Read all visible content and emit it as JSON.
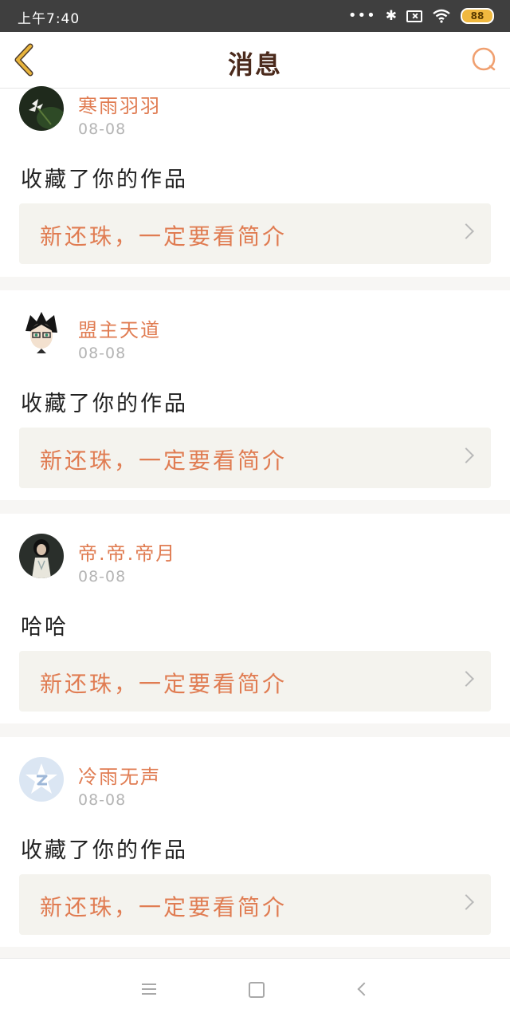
{
  "status_bar": {
    "time": "上午7:40",
    "dots": "•••",
    "bluetooth_glyph": "✱",
    "battery": "88"
  },
  "header": {
    "title": "消息",
    "back_icon": "chevron-left-icon",
    "search_icon": "search-icon"
  },
  "messages": [
    {
      "nickname": "寒雨羽羽",
      "date": "08-08",
      "text": "收藏了你的作品",
      "work_title": "新还珠，一定要看简介",
      "avatar": "flower-avatar"
    },
    {
      "nickname": "盟主天道",
      "date": "08-08",
      "text": "收藏了你的作品",
      "work_title": "新还珠，一定要看简介",
      "avatar": "anime-boy-avatar"
    },
    {
      "nickname": "帝.帝.帝月",
      "date": "08-08",
      "text": "哈哈",
      "work_title": "新还珠，一定要看简介",
      "avatar": "girl-avatar"
    },
    {
      "nickname": "冷雨无声",
      "date": "08-08",
      "text": "收藏了你的作品",
      "work_title": "新还珠，一定要看简介",
      "avatar": "default-qq-avatar"
    }
  ],
  "colors": {
    "accent": "#e07c52",
    "title": "#4b2a1c",
    "back_icon": "#e8b43c",
    "search_icon": "#f0a070",
    "card_link_bg": "#f4f3ee"
  }
}
